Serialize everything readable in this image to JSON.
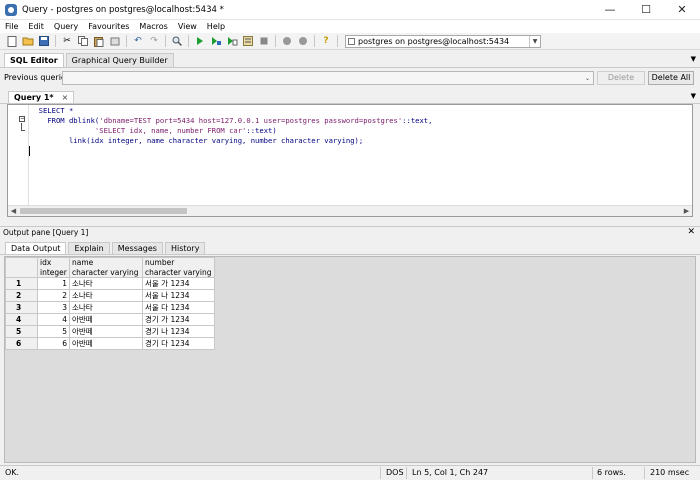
{
  "window": {
    "title": "Query - postgres on postgres@localhost:5434 *",
    "min_glyph": "—",
    "max_glyph": "☐",
    "close_glyph": "✕"
  },
  "menu": [
    "File",
    "Edit",
    "Query",
    "Favourites",
    "Macros",
    "View",
    "Help"
  ],
  "toolbar": {
    "connection": "postgres on postgres@localhost:5434",
    "icons": [
      "new-file",
      "open-file",
      "save-file",
      "cut",
      "copy",
      "paste",
      "clear",
      "undo",
      "redo",
      "find",
      "execute",
      "execute-pgscript",
      "execute-to-file",
      "explain",
      "cancel",
      "analyze",
      "explain-options",
      "help"
    ]
  },
  "editor_tabs": {
    "sql": "SQL Editor",
    "gqb": "Graphical Query Builder"
  },
  "previous_queries": {
    "label": "Previous queries",
    "delete": "Delete",
    "delete_all": "Delete All"
  },
  "query_tab": {
    "label": "Query 1*",
    "close": "×"
  },
  "sql": {
    "l1": "SELECT *",
    "l2_kw": "FROM dblink(",
    "l2_str": "'dbname=TEST port=5434 host=127.0.0.1 user=postgres password=postgres'",
    "l2_end": "::text,",
    "l3_str": "'SELECT idx, name, number FROM car'",
    "l3_end": "::text)",
    "l4": "link(idx integer, name character varying, number character varying);"
  },
  "output": {
    "pane_title": "Output pane [Query 1]",
    "close": "✕",
    "tabs": [
      "Data Output",
      "Explain",
      "Messages",
      "History"
    ],
    "columns": [
      {
        "name": "idx",
        "type": "integer"
      },
      {
        "name": "name",
        "type": "character varying"
      },
      {
        "name": "number",
        "type": "character varying"
      }
    ],
    "rows": [
      {
        "n": "1",
        "idx": "1",
        "name": "소나타",
        "number": "서울 가 1234"
      },
      {
        "n": "2",
        "idx": "2",
        "name": "소나타",
        "number": "서울 나 1234"
      },
      {
        "n": "3",
        "idx": "3",
        "name": "소나타",
        "number": "서울 다 1234"
      },
      {
        "n": "4",
        "idx": "4",
        "name": "아반떼",
        "number": "경기 가 1234"
      },
      {
        "n": "5",
        "idx": "5",
        "name": "아반떼",
        "number": "경기 나 1234"
      },
      {
        "n": "6",
        "idx": "6",
        "name": "아반떼",
        "number": "경기 다 1234"
      }
    ]
  },
  "status": {
    "state": "OK.",
    "encoding": "DOS",
    "position": "Ln 5, Col 1, Ch 247",
    "rows": "6 rows.",
    "time": "210 msec"
  }
}
